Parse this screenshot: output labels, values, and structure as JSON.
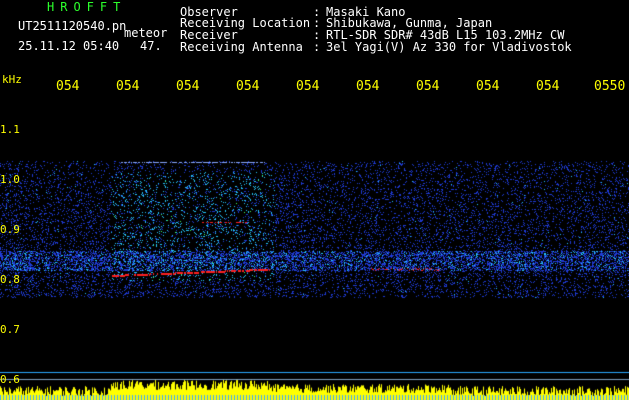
{
  "header": {
    "station_title": "HROFFT",
    "filename": "UT2511120540.pn",
    "meteor_label": "meteor",
    "datetime": "25.11.12 05:40",
    "count": "47.",
    "fields": [
      {
        "label": "Observer",
        "value": "Masaki Kano"
      },
      {
        "label": "Receiving Location",
        "value": "Shibukawa, Gunma, Japan"
      },
      {
        "label": "Receiver",
        "value": "RTL-SDR SDR# 43dB L15 103.2MHz CW"
      },
      {
        "label": "Receiving Antenna",
        "value": "3el Yagi(V) Az 330 for Vladivostok"
      }
    ]
  },
  "spectrogram": {
    "unit_label": "kHz",
    "freq_ticks": [
      "1.1",
      "1.0",
      "0.9",
      "0.8",
      "0.7",
      "0.6"
    ],
    "time_labels": [
      "054",
      "054",
      "054",
      "054",
      "054",
      "054",
      "054",
      "054",
      "054",
      "0550"
    ],
    "colors": {
      "background": "#000000",
      "noise": "#1f3bd6",
      "signal_mid": "#26c8ff",
      "signal_high": "#40ff60",
      "echo": "#ff2020",
      "level_bar": "#ffff00",
      "baseline": "#2aa9ff"
    }
  }
}
